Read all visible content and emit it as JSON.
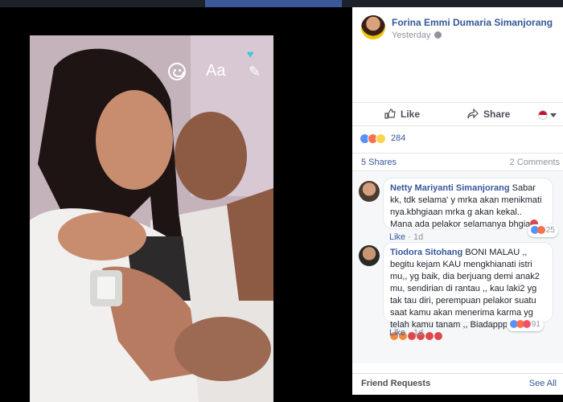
{
  "post": {
    "author": "Forina Emmi Dumaria Simanjorang",
    "time": "Yesterday",
    "photo_overlay": {
      "text_tool": "Aa"
    }
  },
  "actions": {
    "like": "Like",
    "share": "Share"
  },
  "reactions": {
    "count": "284"
  },
  "stats": {
    "shares": "5 Shares",
    "comments": "2 Comments"
  },
  "comments": [
    {
      "name": "Netty Mariyanti Simanjorang",
      "text": "Sabar kk, tdk selama' y mrka akan menikmati nya.kbhgiaan mrka g akan kekal.. Mana ada pelakor selamanya bhgia",
      "reaction_count": "25",
      "like": "Like",
      "age": "1d"
    },
    {
      "name": "Tiodora Sitohang",
      "text": "BONI MALAU ,, begitu kejam KAU mengkhianati istri mu,, yg baik, dia berjuang demi anak2 mu, sendirian di rantau ,, kau laki2 yg tak tau diri, perempuan pelakor suatu saat kamu akan menerima karma yg telah kamu tanam ,, Biadappp.....",
      "reaction_count": "91",
      "like": "Like",
      "age": "1d"
    }
  ],
  "friend_requests": {
    "title": "Friend Requests",
    "see_all": "See All"
  },
  "colors": {
    "link": "#365899",
    "topbar": "#3b5998"
  }
}
